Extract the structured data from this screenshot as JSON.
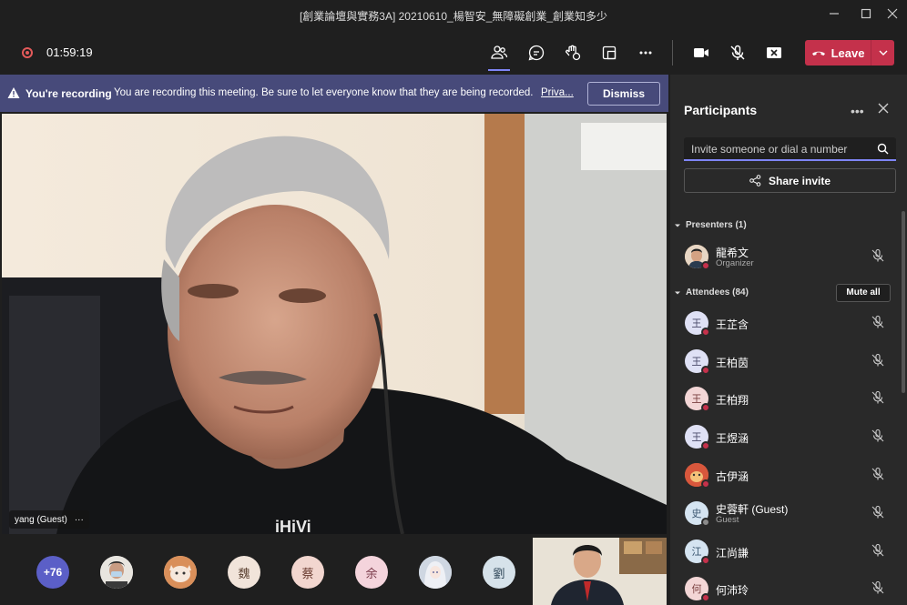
{
  "window": {
    "title": "[創業論壇與實務3A] 20210610_楊智安_無障礙創業_創業知多少"
  },
  "toolbar": {
    "timer": "01:59:19",
    "leave_label": "Leave"
  },
  "banner": {
    "bold": "You're recording",
    "message": "You are recording this meeting. Be sure to let everyone know that they are being recorded.",
    "more": "Priva...",
    "dismiss_label": "Dismiss"
  },
  "video": {
    "speaker_name": "yang (Guest)",
    "more": "···"
  },
  "bottom": {
    "overflow_count": "+76",
    "avatars": [
      "魏",
      "蔡",
      "余",
      "劉"
    ]
  },
  "panel": {
    "title": "Participants",
    "search_placeholder": "Invite someone or dial a number",
    "share_label": "Share invite",
    "presenters_label": "Presenters (1)",
    "attendees_label": "Attendees (84)",
    "mute_all_label": "Mute all",
    "presenters": [
      {
        "name": "龍希文",
        "role": "Organizer"
      }
    ],
    "attendees": [
      {
        "initial": "王",
        "name": "王芷含",
        "role": ""
      },
      {
        "initial": "王",
        "name": "王柏茵",
        "role": ""
      },
      {
        "initial": "王",
        "name": "王柏翔",
        "role": ""
      },
      {
        "initial": "王",
        "name": "王煜涵",
        "role": ""
      },
      {
        "initial": "",
        "name": "古伊涵",
        "role": ""
      },
      {
        "initial": "史",
        "name": "史蓉軒 (Guest)",
        "role": "Guest"
      },
      {
        "initial": "江",
        "name": "江尚謙",
        "role": ""
      },
      {
        "initial": "何",
        "name": "何沛玲",
        "role": ""
      }
    ]
  },
  "colors": {
    "leave": "#c4314b",
    "banner": "#474a7a",
    "accent": "#7f85f5"
  }
}
